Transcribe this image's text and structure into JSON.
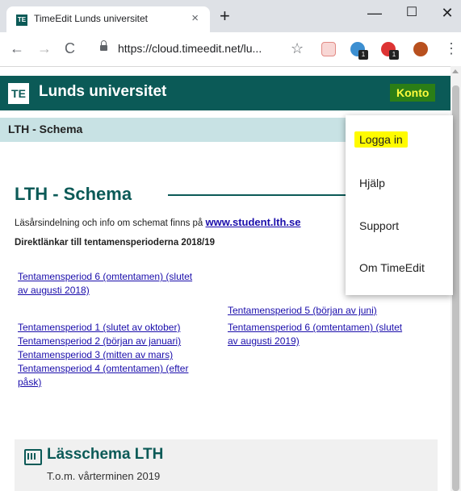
{
  "browser": {
    "tab_title": "TimeEdit Lunds universitet",
    "tab_favicon": "TE",
    "tab_close": "×",
    "new_tab": "+",
    "window_min": "—",
    "window_max": "☐",
    "window_close": "✕",
    "back": "←",
    "forward": "→",
    "reload": "C",
    "url": "https://cloud.timeedit.net/lu...",
    "star": "☆",
    "ext_badge_1": "1",
    "ext_badge_2": "1",
    "menu": "⋮"
  },
  "site_header": {
    "logo": "TE",
    "title": "Lunds universitet",
    "account_label": "Konto"
  },
  "subnav": {
    "title": "LTH - Schema"
  },
  "dropdown": {
    "items": [
      "Logga in",
      "Hjälp",
      "Support",
      "Om TimeEdit"
    ],
    "highlight_color": "#fffb00"
  },
  "main": {
    "heading": "LTH - Schema",
    "intro_text": "Läsårsindelning och info om schemat finns på ",
    "intro_link": "www.student.lth.se",
    "direct_links_text": "Direktlänkar till tentamensperioderna 2018/19",
    "exam_links": [
      "Tentamensperiod 6 (omtentamen) (slutet",
      "av augusti 2018)",
      "Tentamensperiod 1 (slutet av oktober)",
      "Tentamensperiod 2 (början av januari)",
      "Tentamensperiod 3 (mitten av mars)",
      "Tentamensperiod 4 (omtentamen) (efter",
      "påsk)",
      "Tentamensperiod 5 (början av juni)",
      "Tentamensperiod 6 (omtentamen) (slutet",
      "av augusti 2019)"
    ]
  },
  "card": {
    "title": "Lässchema LTH",
    "subtitle": "T.o.m. vårterminen 2019"
  },
  "colors": {
    "brand": "#0b5a57",
    "account_bg": "#2b7e16",
    "account_text": "#fffb3c",
    "link": "#1a0dab",
    "subnav_bg": "#c8e2e4"
  }
}
